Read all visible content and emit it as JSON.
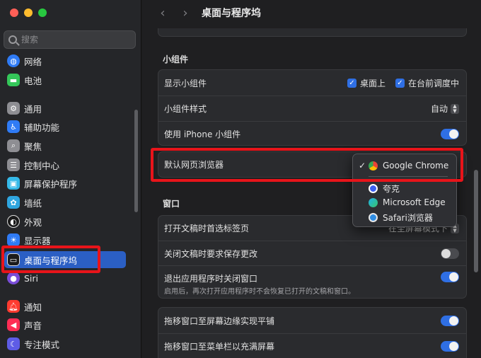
{
  "sidebar": {
    "search_placeholder": "搜索",
    "items": [
      {
        "label": "网络",
        "icon": "globe-icon",
        "color": "#2f7bf5"
      },
      {
        "label": "电池",
        "icon": "battery-icon",
        "color": "#34c759"
      },
      {
        "label": "通用",
        "icon": "gear-icon",
        "color": "#8e8e93"
      },
      {
        "label": "辅助功能",
        "icon": "accessibility-icon",
        "color": "#2f7bf5"
      },
      {
        "label": "聚焦",
        "icon": "magnifier-icon",
        "color": "#8e8e93"
      },
      {
        "label": "控制中心",
        "icon": "control-center-icon",
        "color": "#8e8e93"
      },
      {
        "label": "屏幕保护程序",
        "icon": "screensaver-icon",
        "color": "#35b9e8"
      },
      {
        "label": "墙纸",
        "icon": "wallpaper-icon",
        "color": "#2fa6e0"
      },
      {
        "label": "外观",
        "icon": "appearance-icon",
        "color": "#1b1b1b"
      },
      {
        "label": "显示器",
        "icon": "display-icon",
        "color": "#2f7bf5"
      },
      {
        "label": "桌面与程序坞",
        "icon": "dock-icon",
        "color": "#1b1b1b"
      },
      {
        "label": "Siri",
        "icon": "siri-icon",
        "color": "#7a4dd8"
      },
      {
        "label": "通知",
        "icon": "bell-icon",
        "color": "#ff3b30"
      },
      {
        "label": "声音",
        "icon": "speaker-icon",
        "color": "#ff2d55"
      },
      {
        "label": "专注模式",
        "icon": "moon-icon",
        "color": "#5e5ce6"
      }
    ]
  },
  "header": {
    "title": "桌面与程序坞"
  },
  "widgets": {
    "section_title": "小组件",
    "show_widgets": {
      "label": "显示小组件",
      "opt1": "桌面上",
      "opt2": "在台前调度中"
    },
    "widget_style": {
      "label": "小组件样式",
      "value": "自动"
    },
    "iphone_widgets": {
      "label": "使用 iPhone 小组件"
    }
  },
  "browser": {
    "label": "默认网页浏览器"
  },
  "window_section": {
    "section_title": "窗口",
    "open_tabs": {
      "label": "打开文稿时首选标签页",
      "value": "在全屏幕模式下"
    },
    "ask_save": {
      "label": "关闭文稿时要求保存更改"
    },
    "close_windows": {
      "label": "退出应用程序时关闭窗口",
      "sub": "启用后，再次打开应用程序时不会恢复已打开的文稿和窗口。"
    }
  },
  "tiling": {
    "drag_edge": {
      "label": "拖移窗口至屏幕边缘实现平铺"
    },
    "drag_menubar": {
      "label": "拖移窗口至菜单栏以充满屏幕"
    }
  },
  "popup": {
    "check": "✓",
    "items": [
      {
        "label": "Google Chrome",
        "icon": "chrome-icon"
      },
      {
        "label": "夸克",
        "icon": "quark-icon"
      },
      {
        "label": "Microsoft Edge",
        "icon": "edge-icon"
      },
      {
        "label": "Safari浏览器",
        "icon": "safari-icon"
      }
    ]
  }
}
